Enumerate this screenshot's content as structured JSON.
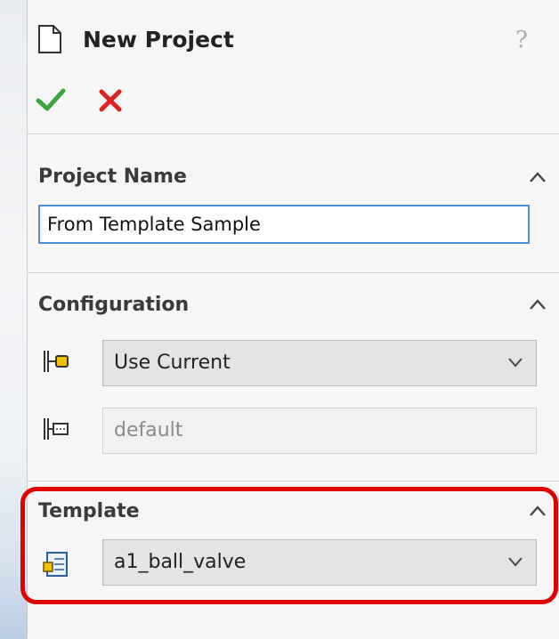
{
  "header": {
    "title": "New Project",
    "help_label": "?"
  },
  "project_name": {
    "title": "Project Name",
    "value": "From Template Sample"
  },
  "configuration": {
    "title": "Configuration",
    "selected": "Use Current",
    "sub_value": "default"
  },
  "template": {
    "title": "Template",
    "selected": "a1_ball_valve"
  },
  "colors": {
    "ok_green": "#3aa63a",
    "cancel_red": "#e02020",
    "highlight_red": "#e00000",
    "input_border_blue": "#4a90d9"
  }
}
